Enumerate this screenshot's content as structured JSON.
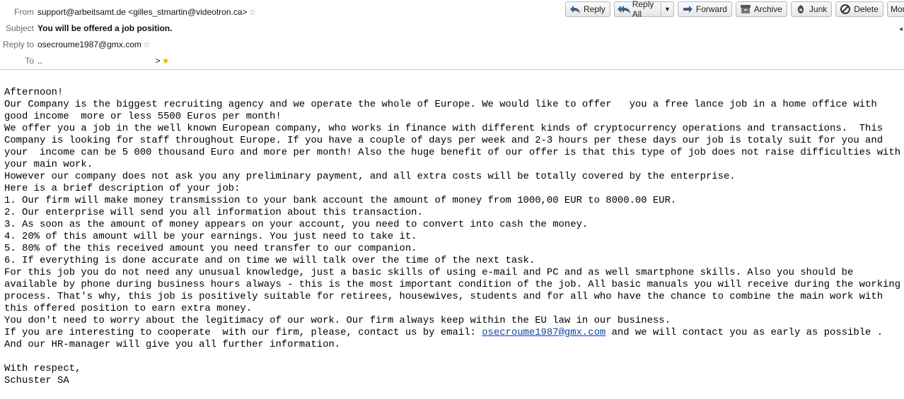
{
  "header": {
    "from_label": "From",
    "from_value": "support@arbeitsamt.de <gilles_stmartin@videotron.ca>",
    "subject_label": "Subject",
    "subject_value": "You will be offered a job position.",
    "replyto_label": "Reply to",
    "replyto_value": "osecroume1987@gmx.com",
    "to_label": "To",
    "to_prefix": "..",
    "to_suffix": ">"
  },
  "toolbar": {
    "reply": "Reply",
    "reply_all": "Reply All",
    "forward": "Forward",
    "archive": "Archive",
    "junk": "Junk",
    "delete": "Delete",
    "more": "More"
  },
  "body": {
    "greeting": "Afternoon!",
    "p1": "Our Company is the biggest recruiting agency and we operate the whole of Europe. We would like to offer   you a free lance job in a home office with good income  more or less 5500 Euros per month!",
    "p2": "We offer you a job in the well known European company, who works in finance with different kinds of cryptocurrency operations and transactions.  This  Company is looking for staff throughout Europe. If you have a couple of days per week and 2-3 hours per these days our job is totaly suit for you and your  income can be 5 000 thousand Euro and more per month! Also the huge benefit of our offer is that this type of job does not raise difficulties with your main work.",
    "p3": "However our company does not ask you any preliminary payment, and all extra costs will be totally covered by the enterprise.",
    "p4": "Here is a brief description of your job:",
    "items": [
      "1. Our firm will make money transmission to your bank account the amount of money from 1000,00 EUR to 8000.00 EUR.",
      "2. Our enterprise will send you all information about this transaction.",
      "3. As soon as the amount of money appears on your account, you need to convert into cash the money.",
      "4. 20% of this amount will be your earnings. You just need to take it.",
      "5. 80% of the this received amount you need transfer to our companion.",
      "6. If everything is done accurate and on time we will talk over the time of the next task."
    ],
    "p5": "For this job you do not need any unusual knowledge, just a basic skills of using e-mail and PC and as well smartphone skills. Also you should be available by phone during business hours always - this is the most important condition of the job. All basic manuals you will receive during the working process. That's why, this job is positively suitable for retirees, housewives, students and for all who have the chance to combine the main work with this offered position to earn extra money.",
    "p6": "You don't need to worry about the legitimacy of our work. Our firm always keep within the EU law in our business.",
    "p7_before": "If you are interesting to cooperate  with our firm, please, contact us by email: ",
    "p7_link": "osecroume1987@gmx.com",
    "p7_after": " and we will contact you as early as possible . And our HR-manager will give you all further information.",
    "closing": "With respect,",
    "signature": "Schuster SA"
  },
  "colors": {
    "link": "#0645ad",
    "label_gray": "#6d6d6d",
    "star_favorite": "#e6b800"
  },
  "icons": [
    "star-icon",
    "reply-icon",
    "reply-all-icon",
    "forward-icon",
    "archive-icon",
    "junk-icon",
    "delete-icon",
    "chevron-down-icon"
  ]
}
